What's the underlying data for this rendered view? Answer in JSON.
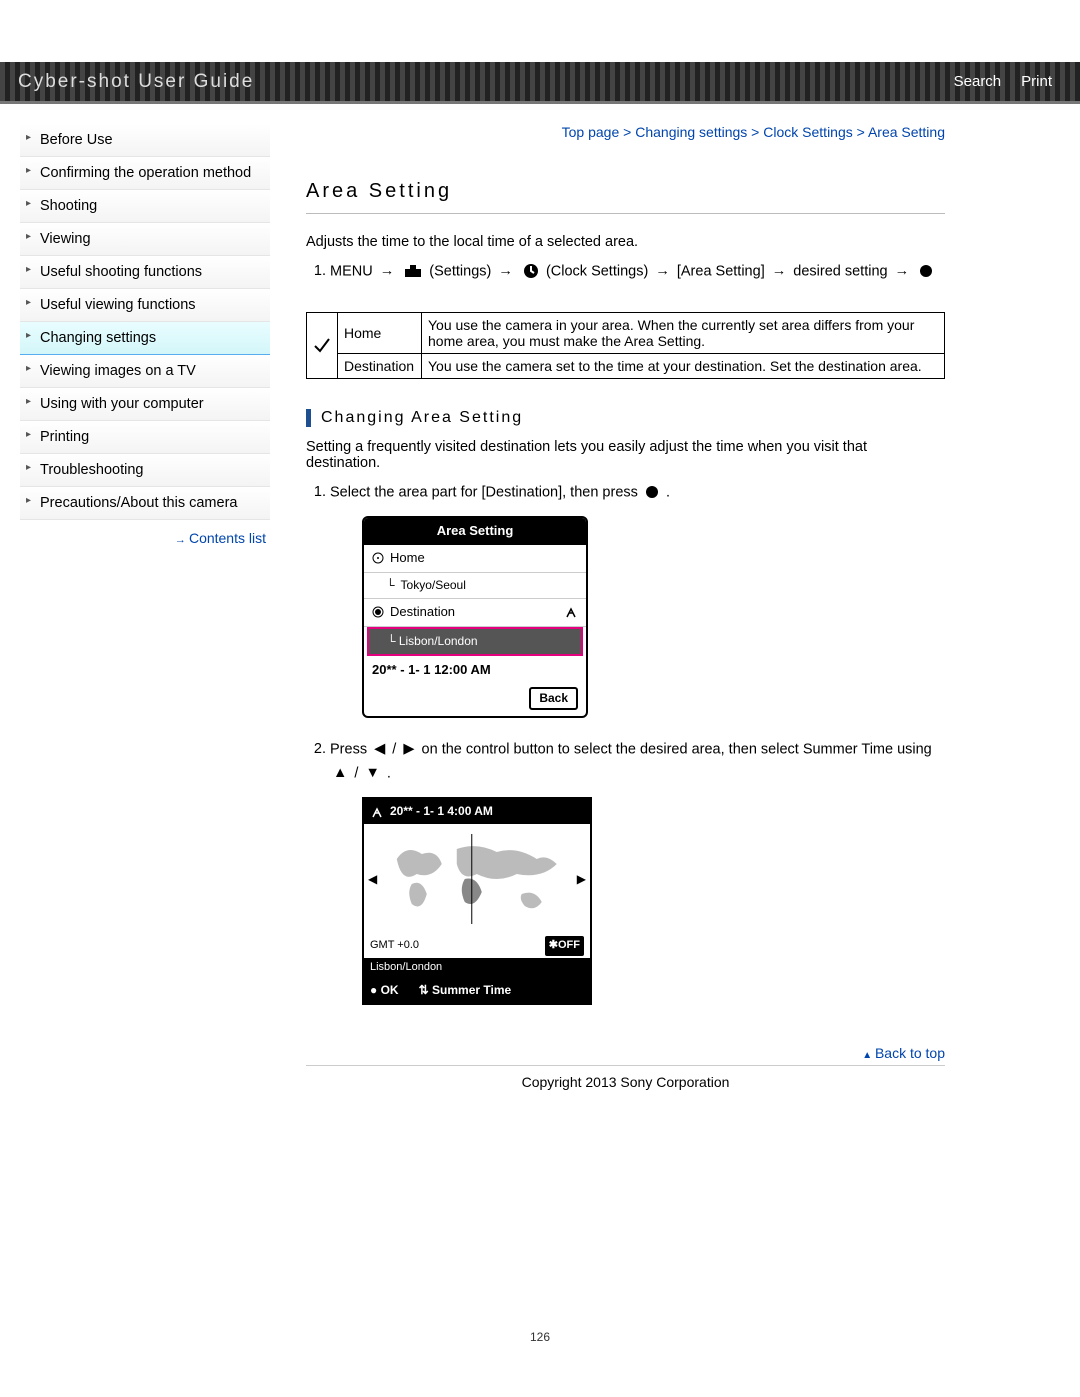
{
  "header": {
    "title": "Cyber-shot User Guide",
    "search": "Search",
    "print": "Print"
  },
  "sidebar": {
    "items": [
      "Before Use",
      "Confirming the operation method",
      "Shooting",
      "Viewing",
      "Useful shooting functions",
      "Useful viewing functions",
      "Changing settings",
      "Viewing images on a TV",
      "Using with your computer",
      "Printing",
      "Troubleshooting",
      "Precautions/About this camera"
    ],
    "active_index": 6,
    "contents": "Contents list"
  },
  "breadcrumb": {
    "parts": [
      "Top page",
      "Changing settings",
      "Clock Settings",
      "Area Setting"
    ],
    "sep": " > "
  },
  "main": {
    "title": "Area Setting",
    "intro": "Adjusts the time to the local time of a selected area.",
    "step1": {
      "menu": "MENU",
      "settings": "(Settings)",
      "clock": "(Clock Settings)",
      "area": "[Area Setting]",
      "desired": "desired setting"
    },
    "table": {
      "rows": [
        {
          "label": "Home",
          "desc": "You use the camera in your area. When the currently set area differs from your home area, you must make the Area Setting."
        },
        {
          "label": "Destination",
          "desc": "You use the camera set to the time at your destination. Set the destination area."
        }
      ]
    },
    "sub_title": "Changing Area Setting",
    "sub_intro": "Setting a frequently visited destination lets you easily adjust the time when you visit that destination.",
    "step_a": "Select the area part for [Destination], then press",
    "step_a_end": ".",
    "screen1": {
      "title": "Area Setting",
      "home": "Home",
      "home_zone": "Tokyo/Seoul",
      "dest": "Destination",
      "dest_zone": "Lisbon/London",
      "time": "20** - 1- 1 12:00 AM",
      "back": "Back"
    },
    "step_b_a": "Press",
    "step_b_b": "/",
    "step_b_c": "on the control button to select the desired area, then select Summer Time using",
    "step_b_d": "/",
    "step_b_e": ".",
    "screen2": {
      "head_time": "20** - 1- 1  4:00 AM",
      "gmt": "GMT +0.0",
      "off": "✱OFF",
      "zone": "Lisbon/London",
      "ok": "● OK",
      "summer": "Summer Time"
    },
    "back_to_top": "Back to top"
  },
  "footer": {
    "copyright": "Copyright 2013 Sony Corporation",
    "page_num": "126"
  }
}
